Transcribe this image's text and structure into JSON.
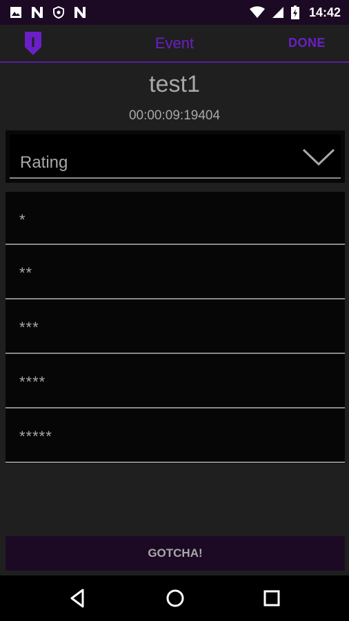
{
  "status_bar": {
    "time": "14:42",
    "left_icons": [
      "image-icon",
      "n-app-icon",
      "shield-icon",
      "n-app-icon"
    ],
    "right_icons": [
      "wifi-icon",
      "cell-signal-icon",
      "battery-icon"
    ]
  },
  "app_bar": {
    "title": "Event",
    "done_label": "DONE",
    "accent_color": "#6b1fc7"
  },
  "event": {
    "name": "test1",
    "elapsed": "00:00:09:19404"
  },
  "rating": {
    "label": "Rating",
    "options": [
      "*",
      "**",
      "***",
      "****",
      "*****"
    ]
  },
  "gotcha_label": "GOTCHA!",
  "nav_bar": {
    "icons": [
      "back-icon",
      "home-icon",
      "recents-icon"
    ]
  }
}
